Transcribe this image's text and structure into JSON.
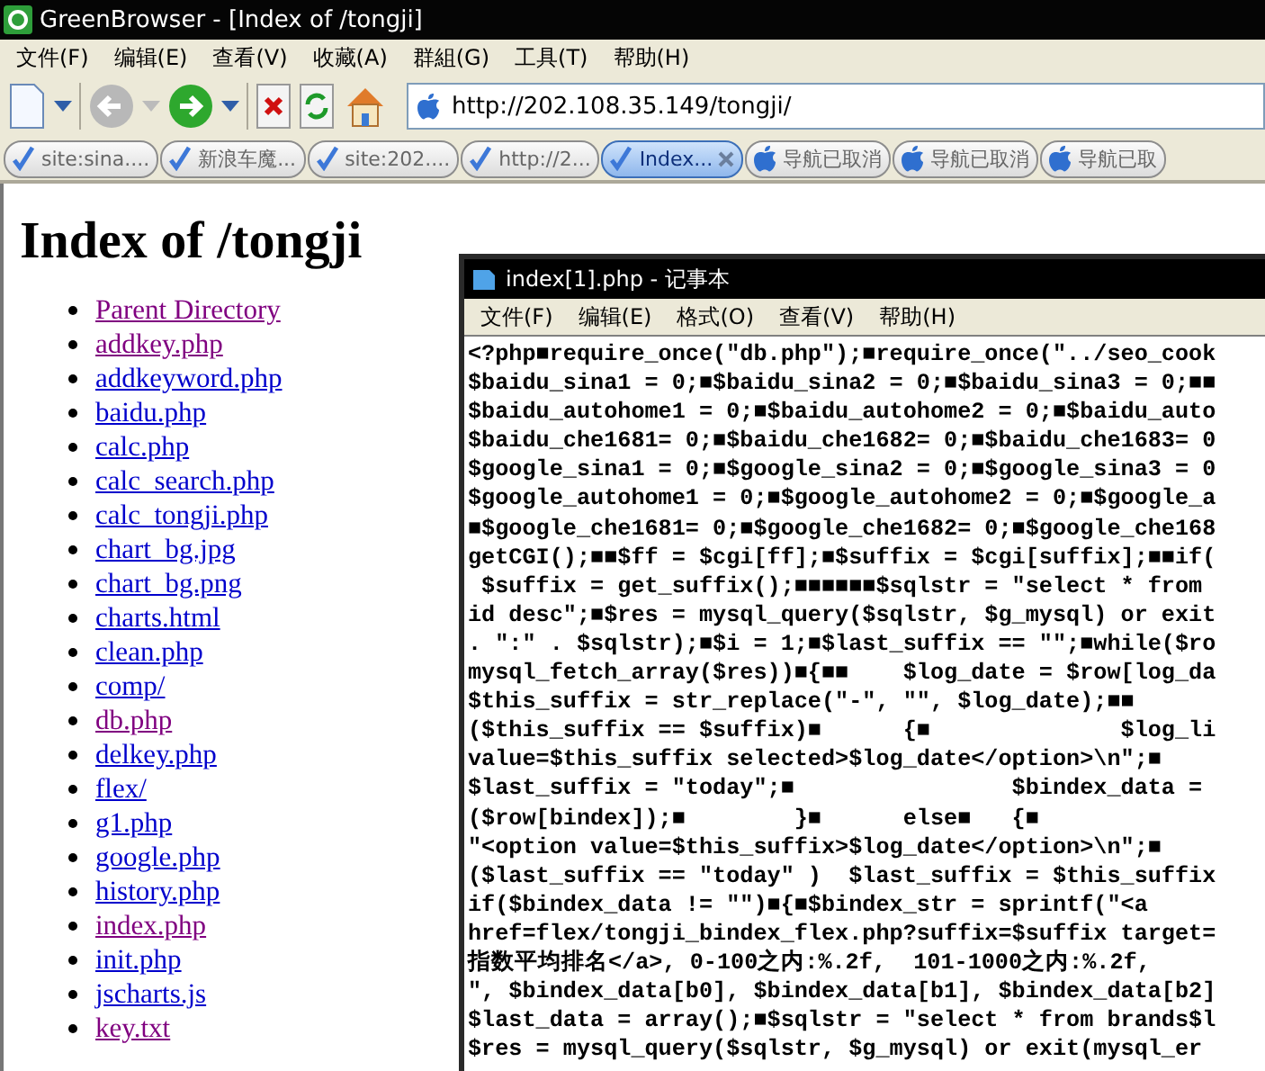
{
  "window": {
    "title": "GreenBrowser - [Index of /tongji]"
  },
  "menu": [
    "文件(F)",
    "编辑(E)",
    "查看(V)",
    "收藏(A)",
    "群組(G)",
    "工具(T)",
    "帮助(H)"
  ],
  "address": {
    "value": "http://202.108.35.149/tongji/"
  },
  "tabs": [
    {
      "label": "site:sina....",
      "kind": "loaded",
      "selected": false
    },
    {
      "label": "新浪车魔...",
      "kind": "loaded",
      "selected": false
    },
    {
      "label": "site:202....",
      "kind": "loaded",
      "selected": false
    },
    {
      "label": "http://2...",
      "kind": "loaded",
      "selected": false
    },
    {
      "label": "Index...",
      "kind": "loaded",
      "selected": true
    },
    {
      "label": "导航已取消",
      "kind": "cancelled",
      "selected": false
    },
    {
      "label": "导航已取消",
      "kind": "cancelled",
      "selected": false
    },
    {
      "label": "导航已取",
      "kind": "cancelled",
      "selected": false
    }
  ],
  "page": {
    "heading": "Index of /tongji",
    "links": [
      {
        "text": "Parent Directory",
        "visited": true
      },
      {
        "text": "addkey.php",
        "visited": true
      },
      {
        "text": "addkeyword.php",
        "visited": false
      },
      {
        "text": "baidu.php",
        "visited": false
      },
      {
        "text": "calc.php",
        "visited": false
      },
      {
        "text": "calc_search.php",
        "visited": false
      },
      {
        "text": "calc_tongji.php",
        "visited": false
      },
      {
        "text": "chart_bg.jpg",
        "visited": false
      },
      {
        "text": "chart_bg.png",
        "visited": false
      },
      {
        "text": "charts.html",
        "visited": false
      },
      {
        "text": "clean.php",
        "visited": false
      },
      {
        "text": "comp/",
        "visited": false
      },
      {
        "text": "db.php",
        "visited": true
      },
      {
        "text": "delkey.php",
        "visited": false
      },
      {
        "text": "flex/",
        "visited": false
      },
      {
        "text": "g1.php",
        "visited": false
      },
      {
        "text": "google.php",
        "visited": false
      },
      {
        "text": "history.php",
        "visited": false
      },
      {
        "text": "index.php",
        "visited": true
      },
      {
        "text": "init.php",
        "visited": false
      },
      {
        "text": "jscharts.js",
        "visited": false
      },
      {
        "text": "key.txt",
        "visited": true
      }
    ]
  },
  "notepad": {
    "title": "index[1].php - 记事本",
    "menu": [
      "文件(F)",
      "编辑(E)",
      "格式(O)",
      "查看(V)",
      "帮助(H)"
    ],
    "lines": [
      "<?php■require_once(\"db.php\");■require_once(\"../seo_cook",
      "$baidu_sina1 = 0;■$baidu_sina2 = 0;■$baidu_sina3 = 0;■■",
      "$baidu_autohome1 = 0;■$baidu_autohome2 = 0;■$baidu_auto",
      "$baidu_che1681= 0;■$baidu_che1682= 0;■$baidu_che1683= 0",
      "$google_sina1 = 0;■$google_sina2 = 0;■$google_sina3 = 0",
      "$google_autohome1 = 0;■$google_autohome2 = 0;■$google_a",
      "■$google_che1681= 0;■$google_che1682= 0;■$google_che168",
      "getCGI();■■$ff = $cgi[ff];■$suffix = $cgi[suffix];■■if(",
      " $suffix = get_suffix();■■■■■■$sqlstr = \"select * from",
      "id desc\";■$res = mysql_query($sqlstr, $g_mysql) or exit",
      ". \":\" . $sqlstr);■$i = 1;■$last_suffix == \"\";■while($ro",
      "mysql_fetch_array($res))■{■■    $log_date = $row[log_da",
      "$this_suffix = str_replace(\"-\", \"\", $log_date);■■",
      "($this_suffix == $suffix)■      {■              $log_li",
      "value=$this_suffix selected>$log_date</option>\\n\";■",
      "$last_suffix = \"today\";■                $bindex_data =",
      "($row[bindex]);■        }■      else■   {■",
      "\"<option value=$this_suffix>$log_date</option>\\n\";■",
      "($last_suffix == \"today\" )  $last_suffix = $this_suffix",
      "if($bindex_data != \"\")■{■$bindex_str = sprintf(\"<a",
      "href=flex/tongji_bindex_flex.php?suffix=$suffix target=",
      "指数平均排名</a>, 0-100之内:%.2f,  101-1000之内:%.2f,",
      "\", $bindex_data[b0], $bindex_data[b1], $bindex_data[b2]",
      "$last_data = array();■$sqlstr = \"select * from brands$l",
      "$res = mysql_query($sqlstr, $g_mysql) or exit(mysql_er"
    ]
  }
}
